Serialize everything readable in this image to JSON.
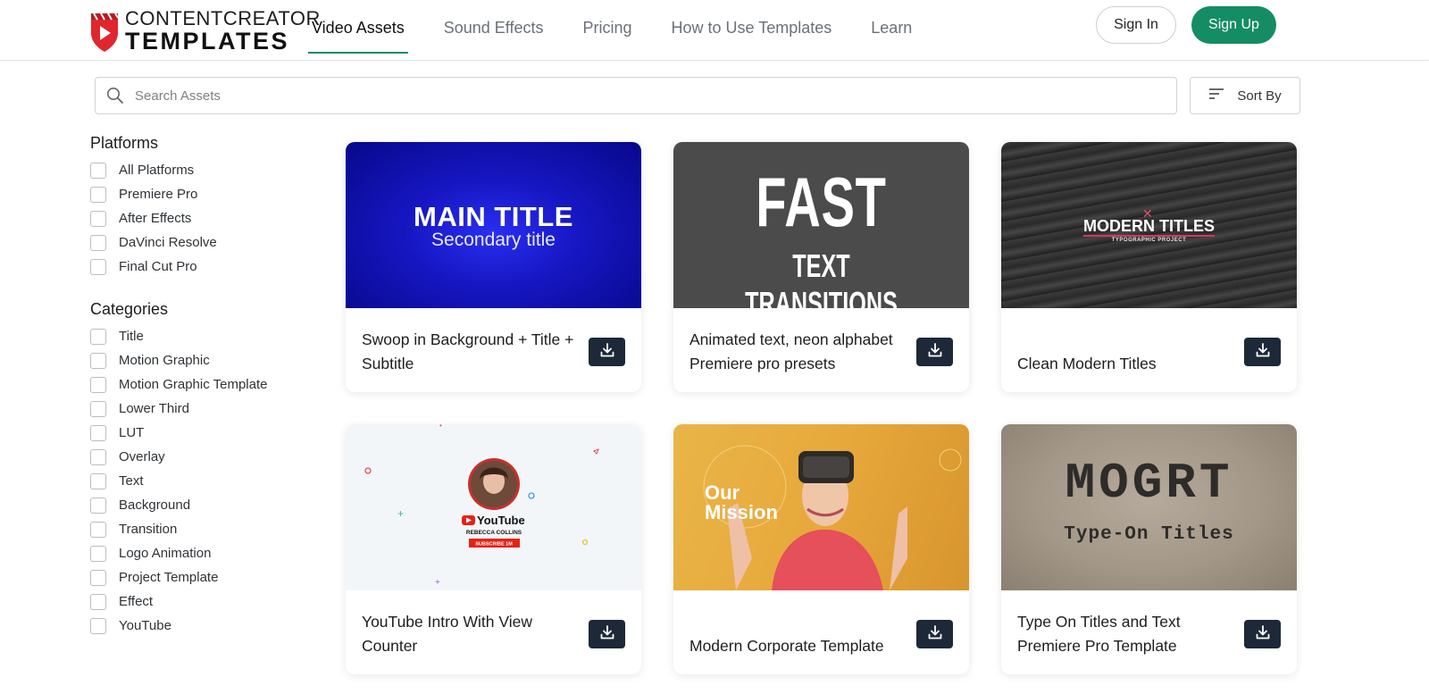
{
  "logo": {
    "line1": "CONTENTCREATOR",
    "line2": "TEMPLATES"
  },
  "nav": {
    "items": [
      {
        "label": "Video Assets",
        "active": true
      },
      {
        "label": "Sound Effects",
        "active": false
      },
      {
        "label": "Pricing",
        "active": false
      },
      {
        "label": "How to Use Templates",
        "active": false
      },
      {
        "label": "Learn",
        "active": false
      }
    ]
  },
  "auth": {
    "signin_label": "Sign In",
    "signup_label": "Sign Up"
  },
  "search": {
    "placeholder": "Search Assets",
    "value": ""
  },
  "sort": {
    "label": "Sort By"
  },
  "filters": {
    "platforms": {
      "heading": "Platforms",
      "items": [
        "All Platforms",
        "Premiere Pro",
        "After Effects",
        "DaVinci Resolve",
        "Final Cut Pro"
      ]
    },
    "categories": {
      "heading": "Categories",
      "items": [
        "Title",
        "Motion Graphic",
        "Motion Graphic Template",
        "Lower Third",
        "LUT",
        "Overlay",
        "Text",
        "Background",
        "Transition",
        "Logo Animation",
        "Project Template",
        "Effect",
        "YouTube"
      ]
    }
  },
  "assets": [
    {
      "title": "Swoop in Background + Title + Subtitle",
      "thumb_text": [
        "MAIN TITLE",
        "Secondary title"
      ]
    },
    {
      "title": "Animated text, neon alphabet Premiere pro presets",
      "thumb_text": [
        "FAST",
        "TEXT TRANSITIONS"
      ]
    },
    {
      "title": "Clean Modern Titles",
      "thumb_text": [
        "MODERN TITLES",
        "TYPOGRAPHIC PROJECT"
      ]
    },
    {
      "title": "YouTube Intro With View Counter",
      "thumb_text": [
        "YouTube",
        "REBECCA COLLINS",
        "SUBSCRIBE 1M"
      ]
    },
    {
      "title": "Modern Corporate Template",
      "thumb_text": [
        "Our",
        "Mission"
      ]
    },
    {
      "title": "Type On Titles and Text Premiere Pro Template",
      "thumb_text": [
        "MOGRT",
        "Type-On Titles"
      ]
    }
  ],
  "colors": {
    "accent": "#148c64",
    "download_button": "#1d2838",
    "logo_red": "#e0262f"
  },
  "icons": {
    "search": "search-icon",
    "sort": "sort-lines-icon",
    "download": "download-icon"
  }
}
